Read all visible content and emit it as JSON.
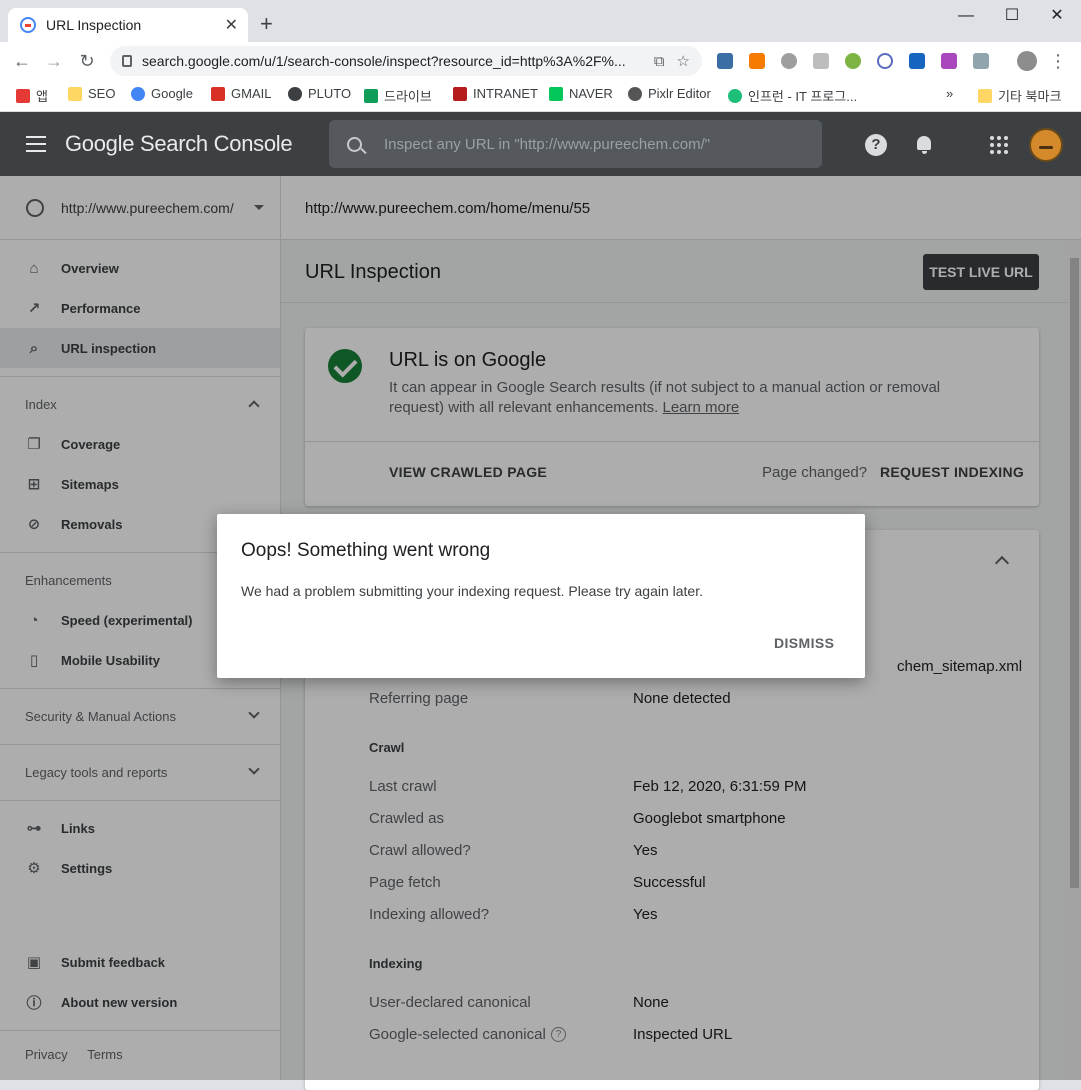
{
  "browser": {
    "tab_title": "URL Inspection",
    "url": "search.google.com/u/1/search-console/inspect?resource_id=http%3A%2F%...",
    "bookmarks": [
      "앱",
      "SEO",
      "Google",
      "GMAIL",
      "PLUTO",
      "드라이브",
      "INTRANET",
      "NAVER",
      "Pixlr Editor",
      "인프런 - IT 프로그...",
      "기타 북마크"
    ],
    "overflow": "»"
  },
  "app": {
    "brand": "Google Search Console",
    "search_placeholder": "Inspect any URL in \"http://www.pureechem.com/\"",
    "help": "?"
  },
  "sidebar": {
    "property": "http://www.pureechem.com/",
    "nav": [
      "Overview",
      "Performance",
      "URL inspection"
    ],
    "index_label": "Index",
    "index_items": [
      "Coverage",
      "Sitemaps",
      "Removals"
    ],
    "enh_label": "Enhancements",
    "enh_items": [
      "Speed (experimental)",
      "Mobile Usability"
    ],
    "security_label": "Security & Manual Actions",
    "legacy_label": "Legacy tools and reports",
    "other_items": [
      "Links",
      "Settings"
    ],
    "feedback": "Submit feedback",
    "about": "About new version",
    "privacy": "Privacy",
    "terms": "Terms"
  },
  "main": {
    "inspected_url": "http://www.pureechem.com/home/menu/55",
    "title": "URL Inspection",
    "test_live": "TEST LIVE URL",
    "status_title": "URL is on Google",
    "status_desc": "It can appear in Google Search results (if not subject to a manual action or removal request) with all relevant enhancements.",
    "learn_more": "Learn more",
    "view_crawled": "VIEW CRAWLED PAGE",
    "page_changed": "Page changed?",
    "request_indexing": "REQUEST INDEXING",
    "sitemap_tail": "chem_sitemap.xml",
    "referring_label": "Referring page",
    "referring_value": "None detected",
    "crawl_heading": "Crawl",
    "crawl_rows": [
      {
        "k": "Last crawl",
        "v": "Feb 12, 2020, 6:31:59 PM"
      },
      {
        "k": "Crawled as",
        "v": "Googlebot smartphone"
      },
      {
        "k": "Crawl allowed?",
        "v": "Yes"
      },
      {
        "k": "Page fetch",
        "v": "Successful"
      },
      {
        "k": "Indexing allowed?",
        "v": "Yes"
      }
    ],
    "indexing_heading": "Indexing",
    "indexing_rows": [
      {
        "k": "User-declared canonical",
        "v": "None"
      },
      {
        "k": "Google-selected canonical",
        "v": "Inspected URL"
      }
    ]
  },
  "dialog": {
    "title": "Oops! Something went wrong",
    "message": "We had a problem submitting your indexing request. Please try again later.",
    "dismiss": "DISMISS"
  }
}
